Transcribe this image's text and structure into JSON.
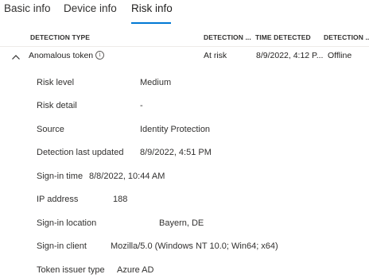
{
  "tabs": [
    {
      "label": "Basic info"
    },
    {
      "label": "Device info"
    },
    {
      "label": "Risk info"
    }
  ],
  "table": {
    "headers": [
      "DETECTION TYPE",
      "DETECTION ...",
      "TIME DETECTED",
      "DETECTION ..."
    ],
    "row": {
      "detection_type": "Anomalous token",
      "info_glyph": "i",
      "risk_state": "At risk",
      "time_detected": "8/9/2022, 4:12 P...",
      "detection_timing": "Offline"
    }
  },
  "details": [
    {
      "label": "Risk level",
      "value": "Medium"
    },
    {
      "label": "Risk detail",
      "value": "-"
    },
    {
      "label": "Source",
      "value": "Identity Protection"
    },
    {
      "label": "Detection last updated",
      "value": "8/9/2022, 4:51 PM"
    },
    {
      "label": "Sign-in time",
      "value": "8/8/2022, 10:44 AM"
    },
    {
      "label": "IP address",
      "value": "188"
    },
    {
      "label": "Sign-in location",
      "value": "Bayern, DE"
    },
    {
      "label": "Sign-in client",
      "value": "Mozilla/5.0 (Windows NT 10.0; Win64; x64)"
    },
    {
      "label": "Token issuer type",
      "value": "Azure AD"
    }
  ],
  "colors": {
    "accent": "#0078d4",
    "text": "#201f1e",
    "divider": "#edebe9"
  },
  "icons": {
    "row_toggle": "chevron-up-icon",
    "detection_info": "info-icon"
  }
}
